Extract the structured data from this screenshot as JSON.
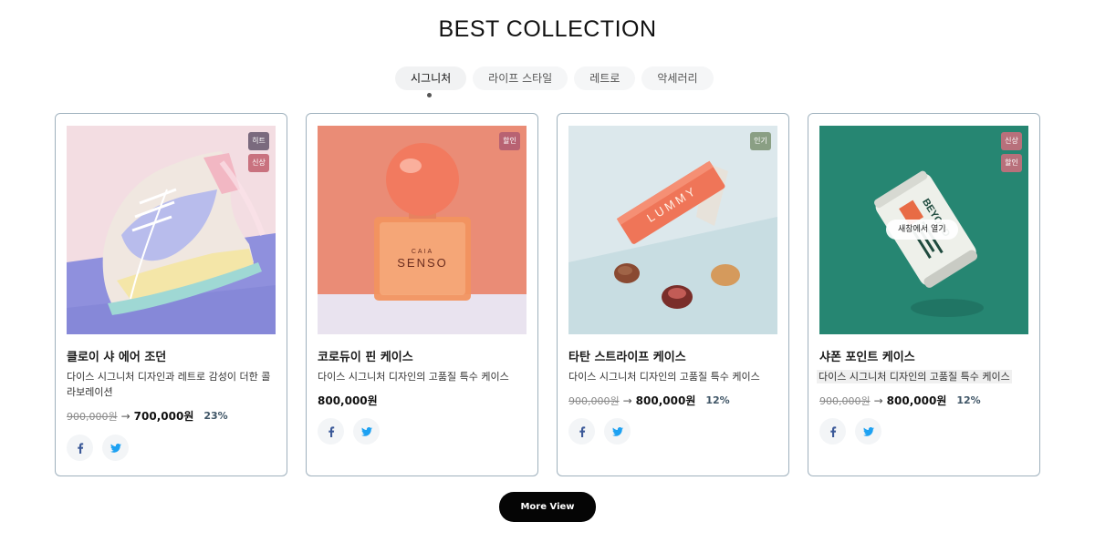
{
  "section": {
    "title": "BEST COLLECTION"
  },
  "tabs": [
    {
      "label": "시그니처",
      "active": true
    },
    {
      "label": "라이프 스타일",
      "active": false
    },
    {
      "label": "레트로",
      "active": false
    },
    {
      "label": "악세러리",
      "active": false
    }
  ],
  "products": [
    {
      "name": "클로이 샤 에어 조던",
      "description": "다이스 시그니처 디자인과 레트로 감성이 더한 콜라보레이션",
      "original_price": "900,000원",
      "price": "700,000원",
      "discount": "23%",
      "badges": [
        {
          "label": "히트",
          "color": "#7a6a7e"
        },
        {
          "label": "신상",
          "color": "#c9727f"
        }
      ]
    },
    {
      "name": "코로듀이 핀 케이스",
      "description": "다이스 시그니처 디자인의 고품질 특수 케이스",
      "price": "800,000원",
      "badges": [
        {
          "label": "할인",
          "color": "#b86272"
        }
      ]
    },
    {
      "name": "타탄 스트라이프 케이스",
      "description": "다이스 시그니처 디자인의 고품질 특수 케이스",
      "original_price": "900,000원",
      "price": "800,000원",
      "discount": "12%",
      "badges": [
        {
          "label": "인기",
          "color": "#8a9f84"
        }
      ]
    },
    {
      "name": "샤폰 포인트 케이스",
      "description": "다이스 시그니처 디자인의 고품질 특수 케이스",
      "original_price": "900,000원",
      "price": "800,000원",
      "discount": "12%",
      "badges": [
        {
          "label": "신상",
          "color": "#b8707b"
        },
        {
          "label": "할인",
          "color": "#b8707b"
        }
      ],
      "hover_action": "새창에서 열기"
    }
  ],
  "images": {
    "product_1": {
      "caption": ""
    },
    "product_2": {
      "text_top": "CAIA",
      "text_main": "SENSO"
    },
    "product_3": {
      "text": "LUMMY"
    },
    "product_4": {
      "text": "BEYOND"
    }
  },
  "social": {
    "facebook_icon": "facebook-icon",
    "twitter_icon": "twitter-icon",
    "facebook_color": "#3b5998",
    "twitter_color": "#1da1f2"
  },
  "more_button": {
    "label": "More View"
  }
}
